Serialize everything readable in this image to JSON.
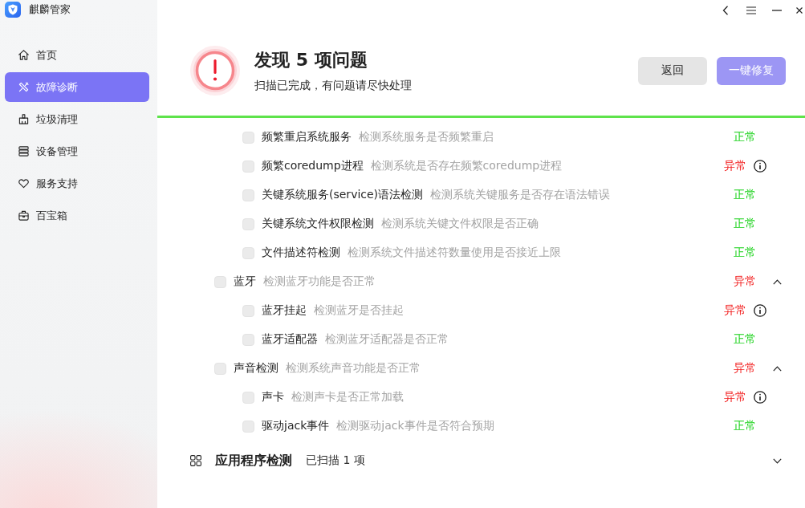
{
  "app": {
    "title": "麒麟管家"
  },
  "sidebar": {
    "items": [
      {
        "label": "首页",
        "selected": false
      },
      {
        "label": "故障诊断",
        "selected": true
      },
      {
        "label": "垃圾清理",
        "selected": false
      },
      {
        "label": "设备管理",
        "selected": false
      },
      {
        "label": "服务支持",
        "selected": false
      },
      {
        "label": "百宝箱",
        "selected": false
      }
    ]
  },
  "header": {
    "title": "发现 5 项问题",
    "subtitle": "扫描已完成，有问题请尽快处理",
    "buttons": [
      {
        "label": "返回",
        "kind": "secondary",
        "disabled": false
      },
      {
        "label": "一键修复",
        "kind": "primary",
        "disabled": true
      }
    ]
  },
  "scan_progress": {
    "level": 1
  },
  "checks": [
    {
      "children": [
        {
          "label": "频繁重启系统服务",
          "description": "检测系统服务是否频繁重启",
          "checked": false,
          "status": "正常",
          "ok": true
        },
        {
          "label": "频繁coredump进程",
          "description": "检测系统是否存在频繁coredump进程",
          "checked": false,
          "status": "异常",
          "ok": false
        },
        {
          "label": "关键系统服务(service)语法检测",
          "description": "检测系统关键服务是否存在语法错误",
          "checked": false,
          "status": "正常",
          "ok": true
        },
        {
          "label": "关键系统文件权限检测",
          "description": "检测系统关键文件权限是否正确",
          "checked": false,
          "status": "正常",
          "ok": true
        },
        {
          "label": "文件描述符检测",
          "description": "检测系统文件描述符数量使用是否接近上限",
          "checked": false,
          "status": "正常",
          "ok": true
        }
      ]
    },
    {
      "label": "蓝牙",
      "description": "检测蓝牙功能是否正常",
      "checked": false,
      "status": "异常",
      "ok": false,
      "expanded": true,
      "children": [
        {
          "label": "蓝牙挂起",
          "description": "检测蓝牙是否挂起",
          "checked": false,
          "status": "异常",
          "ok": false
        },
        {
          "label": "蓝牙适配器",
          "description": "检测蓝牙适配器是否正常",
          "checked": false,
          "status": "正常",
          "ok": true
        }
      ]
    },
    {
      "label": "声音检测",
      "description": "检测系统声音功能是否正常",
      "checked": false,
      "status": "异常",
      "ok": false,
      "expanded": true,
      "children": [
        {
          "label": "声卡",
          "description": "检测声卡是否正常加载",
          "checked": false,
          "status": "异常",
          "ok": false
        },
        {
          "label": "驱动jack事件",
          "description": "检测驱动jack事件是否符合预期",
          "checked": false,
          "status": "正常",
          "ok": true
        }
      ]
    }
  ],
  "sections": [
    {
      "title": "应用程序检测",
      "summary": "已扫描 1 项",
      "expanded": false
    }
  ]
}
